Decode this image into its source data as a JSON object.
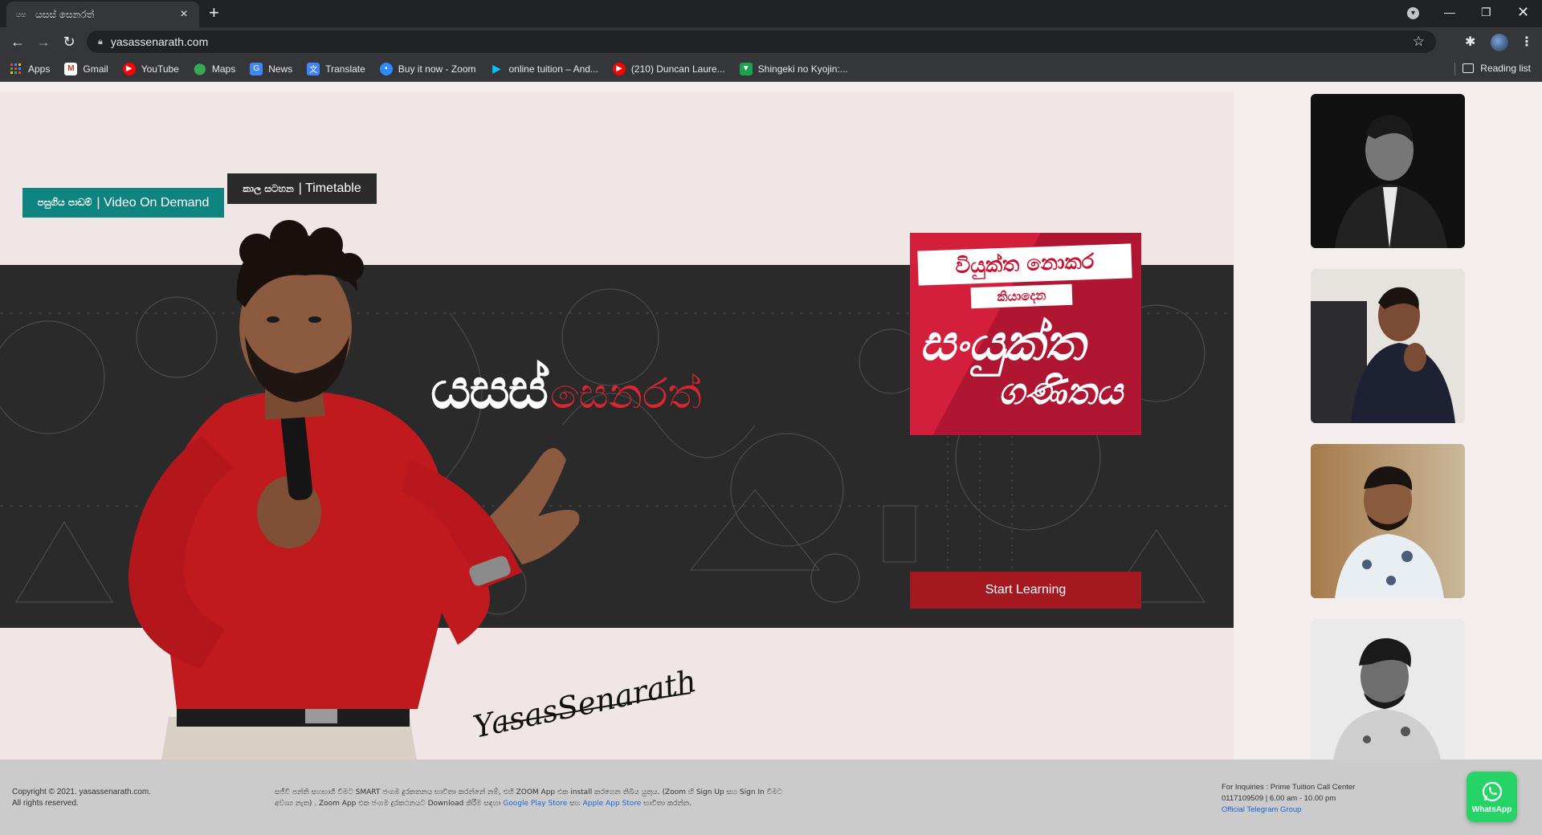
{
  "browser": {
    "tab_title": "යසස් සෙනරත්",
    "tab_favicon_text": "යස",
    "url": "yasassenarath.com",
    "bookmarks": [
      {
        "label": "Apps",
        "icon": "apps-grid-icon",
        "color": "#4285f4"
      },
      {
        "label": "Gmail",
        "icon": "gmail-icon",
        "color": "#d93025"
      },
      {
        "label": "YouTube",
        "icon": "youtube-icon",
        "color": "#ff0000"
      },
      {
        "label": "Maps",
        "icon": "maps-pin-icon",
        "color": "#34a853"
      },
      {
        "label": "News",
        "icon": "google-news-icon",
        "color": "#4285f4"
      },
      {
        "label": "Translate",
        "icon": "google-translate-icon",
        "color": "#4285f4"
      },
      {
        "label": "Buy it now - Zoom",
        "icon": "zoom-icon",
        "color": "#2d8cff"
      },
      {
        "label": "online tuition – And...",
        "icon": "google-play-icon",
        "color": "#00c4ff"
      },
      {
        "label": "(210) Duncan Laure...",
        "icon": "youtube-icon",
        "color": "#ff0000"
      },
      {
        "label": "Shingeki no Kyojin:...",
        "icon": "anime-site-icon",
        "color": "#1aa34a"
      }
    ],
    "reading_list": "Reading list"
  },
  "page": {
    "btn_vod_si": "පසුගිය පාඩම්",
    "btn_vod_en": "| Video On Demand",
    "btn_tt_si": "කාල සටහන",
    "btn_tt_en": "| Timetable",
    "brand_first": "යසස්",
    "brand_last": "සෙනරත්",
    "promo": {
      "line1": "වියුක්ත නොකර",
      "line2": "කියාදෙන",
      "line3": "සංයුක්ත",
      "line4": "ගණිතය"
    },
    "start_learning": "Start Learning",
    "signature": "YasasSenarath",
    "colors": {
      "teal": "#0e8380",
      "dark": "#2a2a2b",
      "red": "#a3191f",
      "promo_red": "#d41f3c"
    }
  },
  "footer": {
    "copyright_line1": "Copyright © 2021. yasassenarath.com.",
    "copyright_line2": "All rights reserved.",
    "note_part1": "සජීවී පන්ති සහභාගී වීමට SMART ජංගම දුරකතනය භාවිතා කරන්නේ නම්, එහි ZOOM App එක install කරගෙන තිබිය යුතුය. (Zoom හි Sign Up සහ Sign In වීමට අවශ්‍ය නැත) . Zoom App එක ජංගම දුරකථනයට Download කිරීම සඳහා",
    "note_link1": "Google Play Store",
    "note_part2": "සහ",
    "note_link2": "Apple App Store",
    "note_part3": "භාවිතා කරන්න.",
    "inquiries_title": "For Inquiries : Prime Tuition Call Center",
    "inquiries_phone": "0117109509 | 6.00 am - 10.00 pm",
    "telegram_link": "Official Telegram Group",
    "whatsapp_label": "WhatsApp"
  }
}
